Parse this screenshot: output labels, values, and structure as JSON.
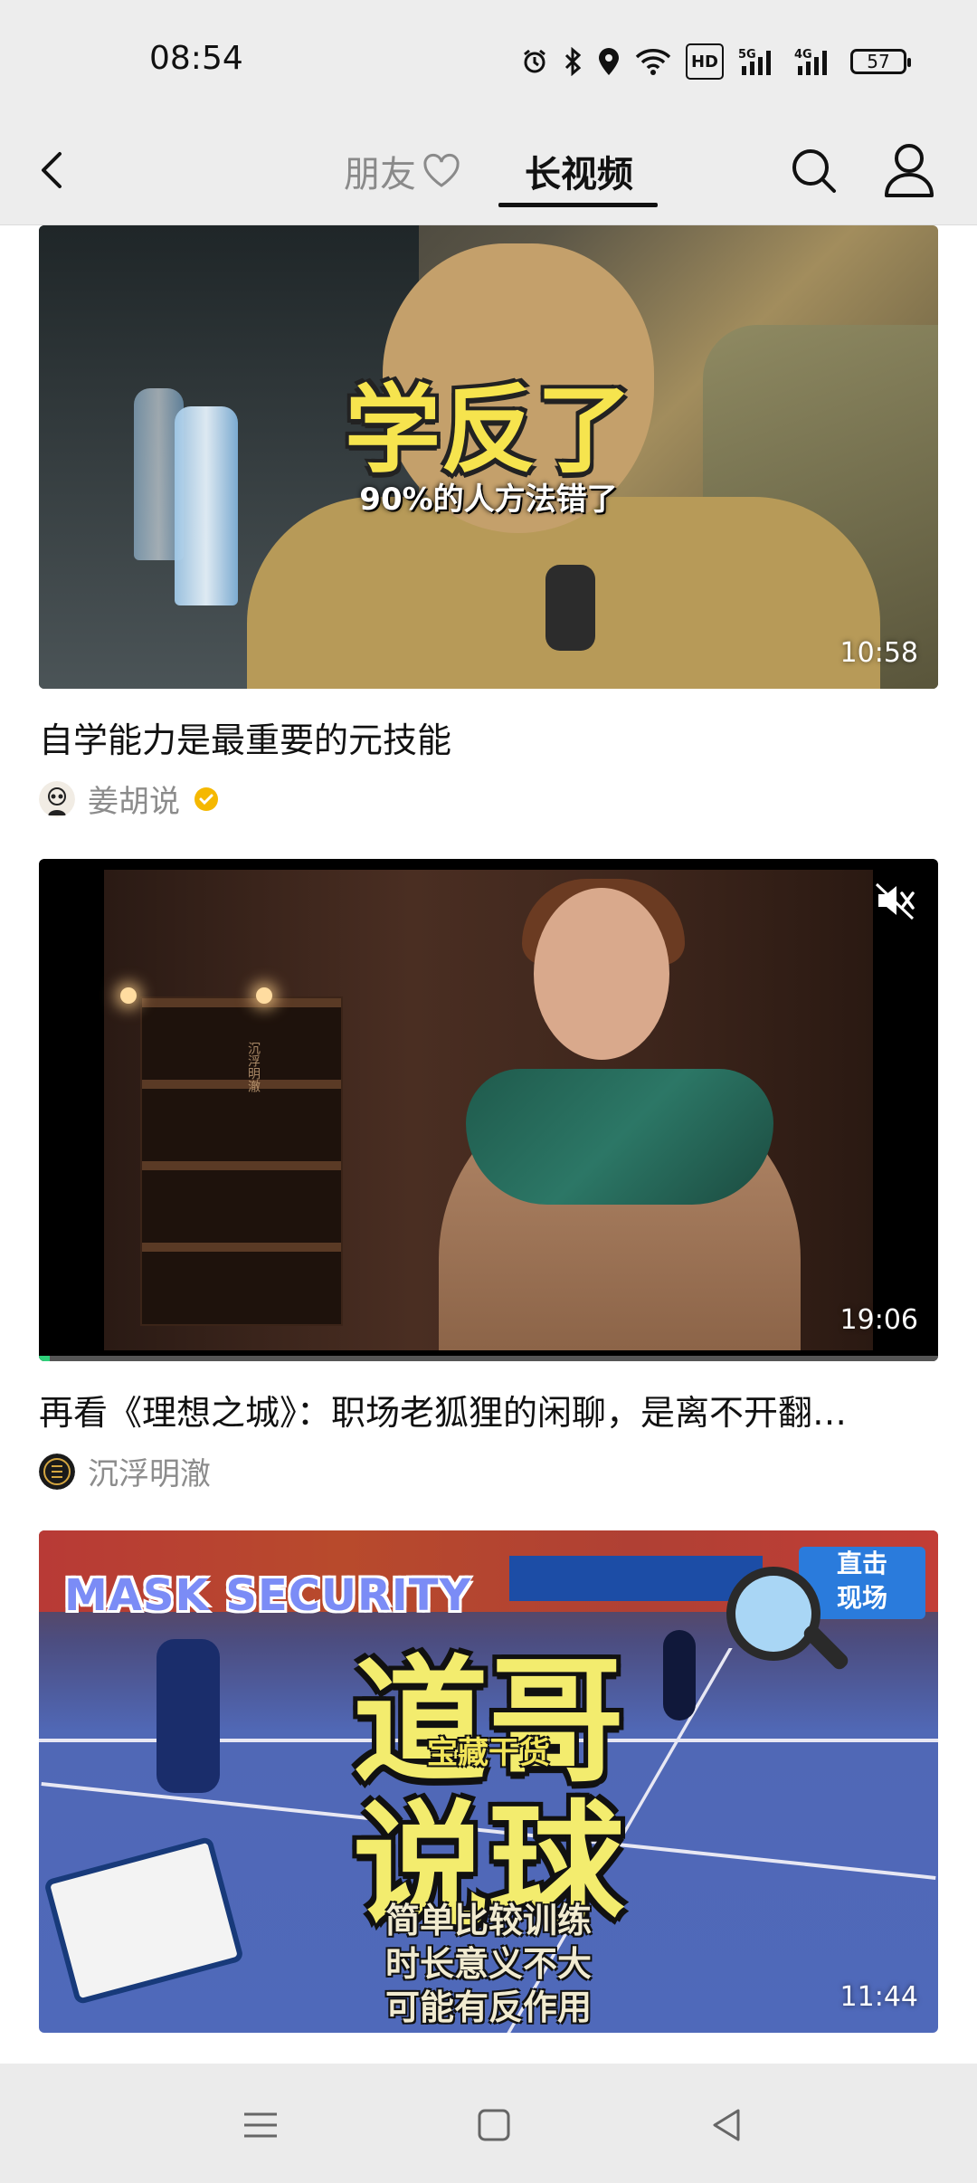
{
  "status_bar": {
    "time": "08:54",
    "network_badges": [
      "HD",
      "5G",
      "4G"
    ],
    "battery": "57",
    "icons": [
      "alarm-icon",
      "bluetooth-icon",
      "location-icon",
      "wifi-icon",
      "hd-icon",
      "signal-5g-icon",
      "signal-4g-icon",
      "battery-icon"
    ]
  },
  "top_nav": {
    "tabs": [
      {
        "label": "朋友",
        "active": false
      },
      {
        "label": "长视频",
        "active": true
      }
    ],
    "icons": [
      "back-icon",
      "heart-icon",
      "search-icon",
      "profile-icon"
    ]
  },
  "feed": [
    {
      "title": "自学能力是最重要的元技能",
      "author": "姜胡说",
      "verified": true,
      "duration": "10:58",
      "overlay_main": "学反了",
      "overlay_sub": "90%的人方法错了"
    },
    {
      "title": "再看《理想之城》：职场老狐狸的闲聊，是离不开翻…",
      "author": "沉浮明澈",
      "verified": false,
      "duration": "19:06",
      "watermark": "沉浮明澈",
      "muted": true
    },
    {
      "title": "",
      "author": "",
      "duration": "11:44",
      "overlay_top": "MASK SECURITY",
      "overlay_main_1": "道哥",
      "overlay_tag": "宝藏干货",
      "overlay_main_2": "说球",
      "overlay_lines": [
        "简单比较训练",
        "时长意义不大",
        "可能有反作用"
      ],
      "live_label_1": "直击",
      "live_label_2": "现场"
    }
  ],
  "colors": {
    "background": "#ffffff",
    "nav_background": "#ededed",
    "inactive_tab": "#8a8a8a",
    "verified_badge": "#f5b800"
  }
}
